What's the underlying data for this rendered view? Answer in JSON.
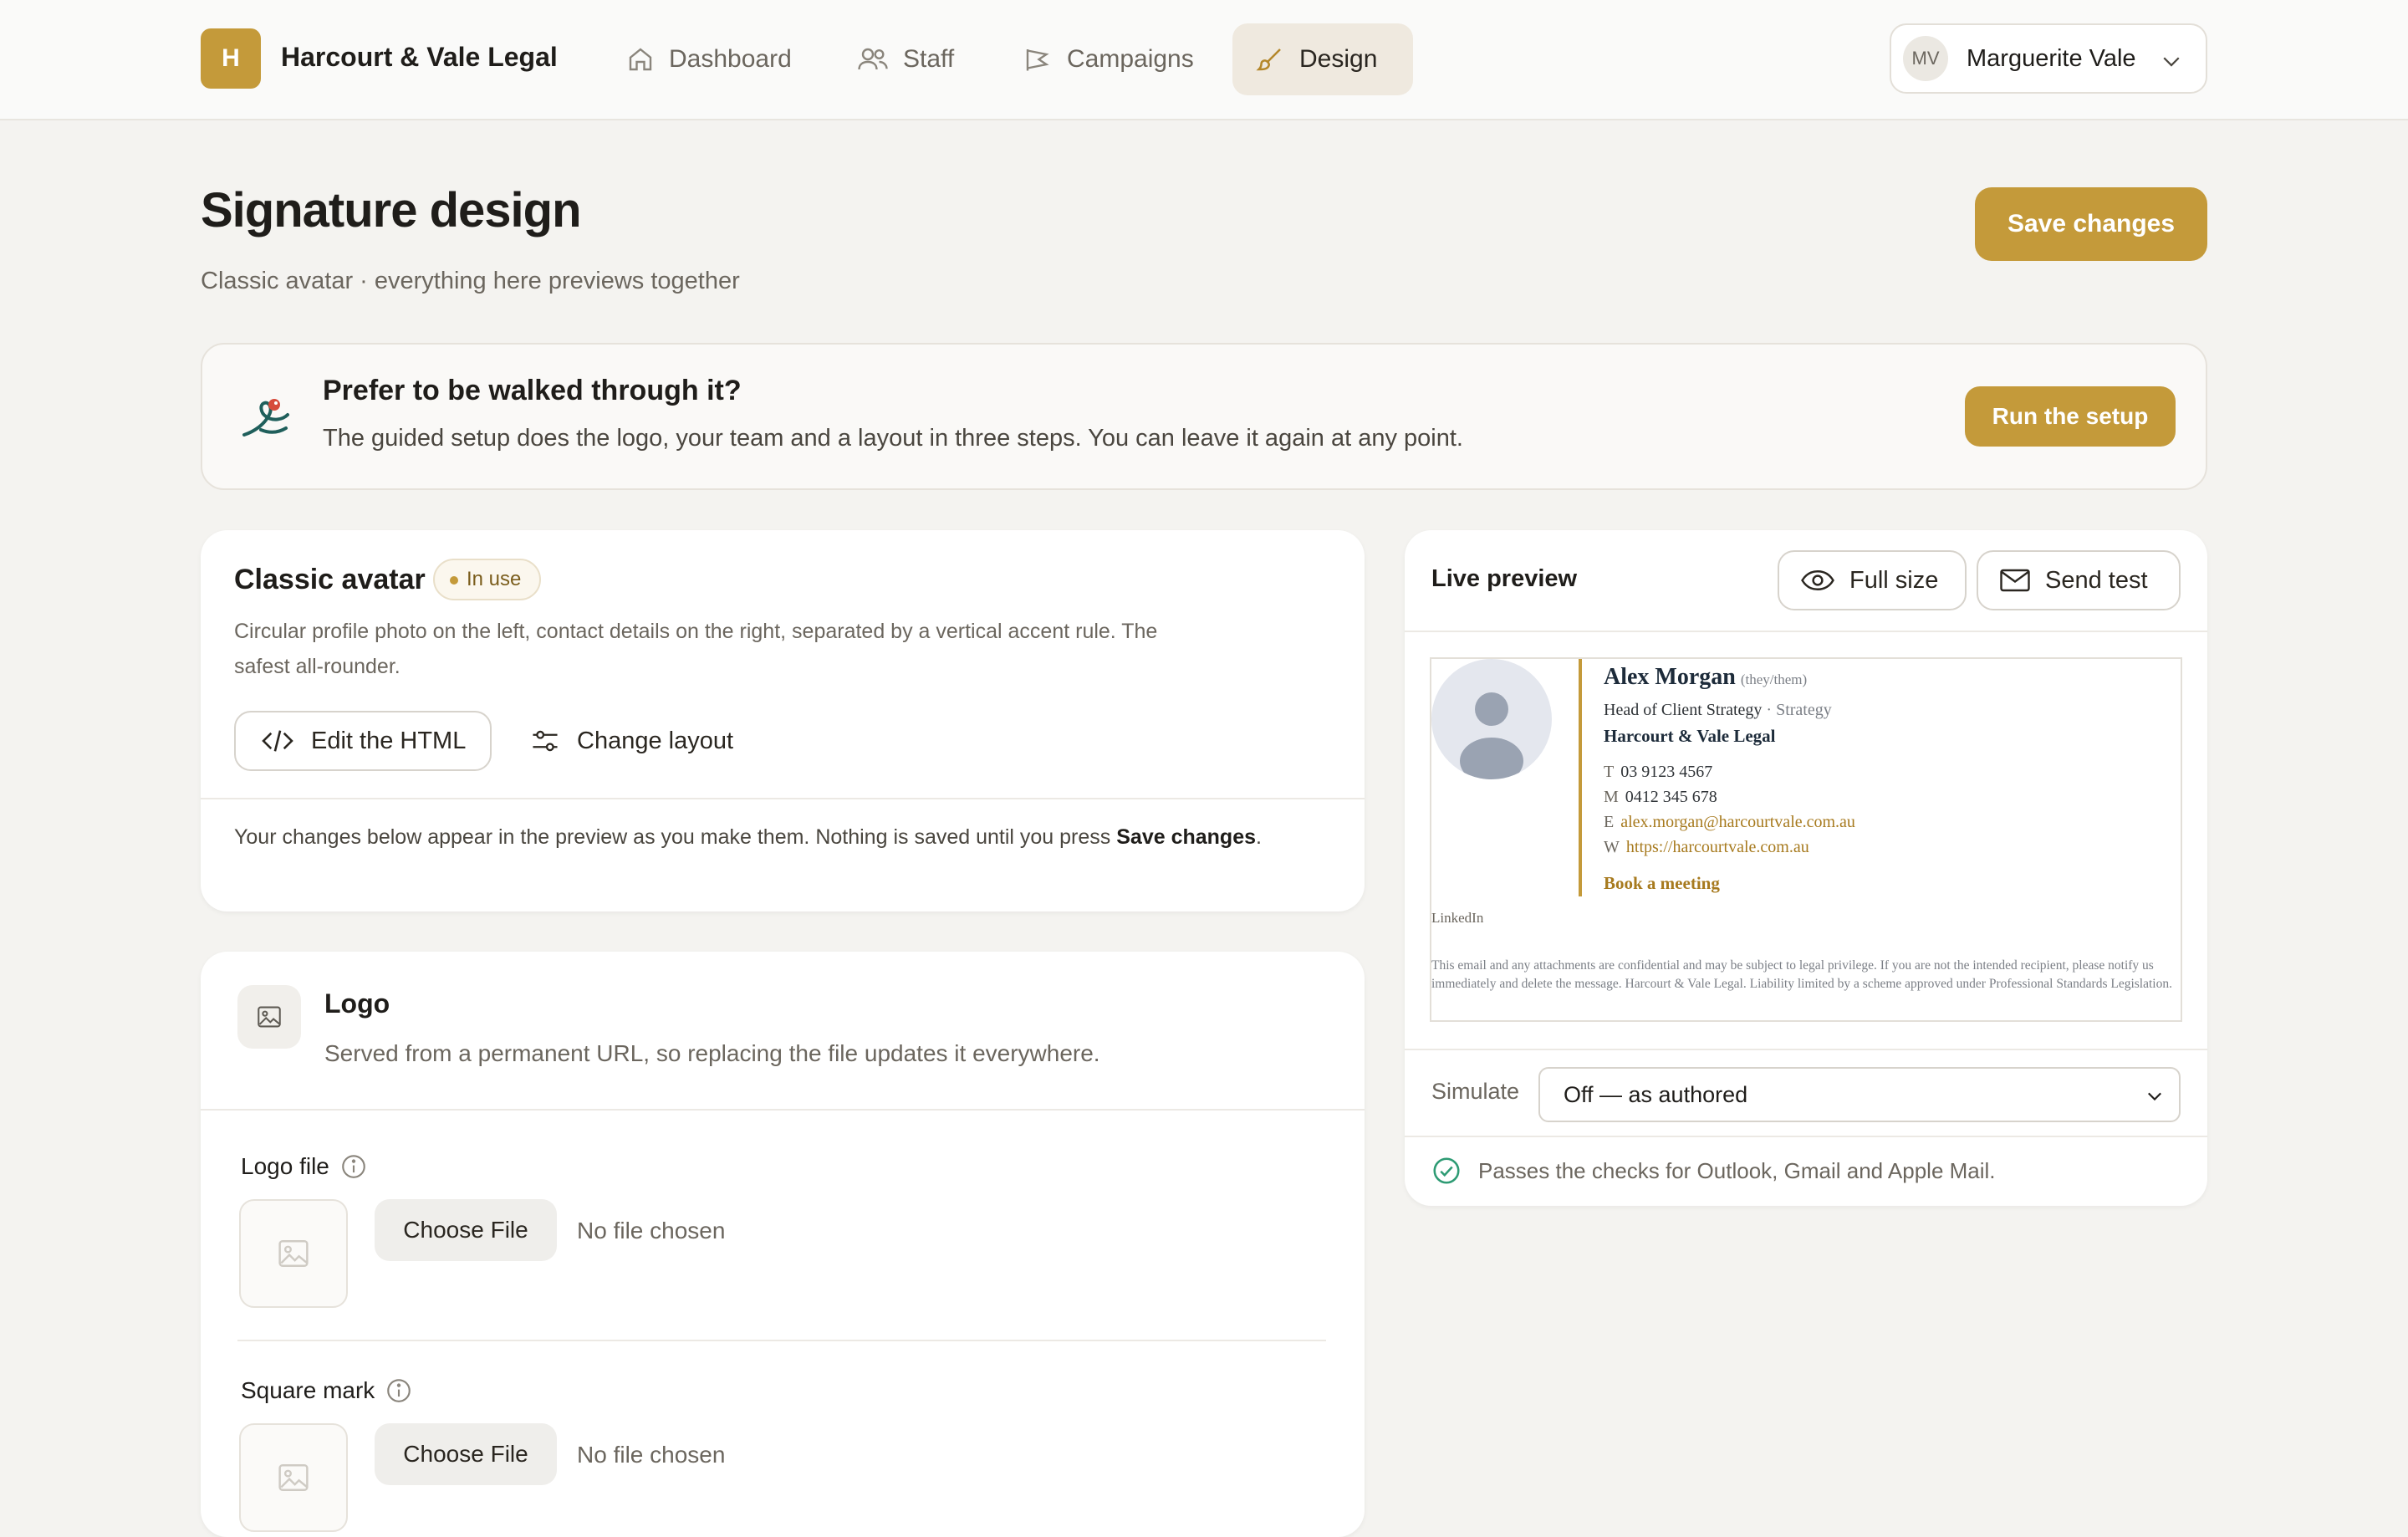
{
  "nav": {
    "brand_initial": "H",
    "brand_name": "Harcourt & Vale Legal",
    "items": [
      {
        "label": "Dashboard",
        "icon": "home-icon"
      },
      {
        "label": "Staff",
        "icon": "users-icon"
      },
      {
        "label": "Campaigns",
        "icon": "megaphone-icon"
      },
      {
        "label": "Design",
        "icon": "brush-icon",
        "active": true
      }
    ],
    "user": {
      "initials": "MV",
      "name": "Marguerite Vale"
    }
  },
  "header": {
    "title": "Signature design",
    "subtitle": "Classic avatar · everything here previews together",
    "save_label": "Save changes"
  },
  "walkthrough": {
    "title": "Prefer to be walked through it?",
    "description": "The guided setup does the logo, your team and a layout in three steps. You can leave it again at any point.",
    "button_label": "Run the setup"
  },
  "layout_card": {
    "title": "Classic avatar",
    "badge": "In use",
    "description": "Circular profile photo on the left, contact details on the right, separated by a vertical accent rule. The safest all-rounder.",
    "edit_html_label": "Edit the HTML",
    "change_layout_label": "Change layout",
    "note_prefix": "Your changes below appear in the preview as you make them. Nothing is saved until you press ",
    "note_bold": "Save changes",
    "note_suffix": "."
  },
  "logo_card": {
    "title": "Logo",
    "description": "Served from a permanent URL, so replacing the file updates it everywhere.",
    "fields": [
      {
        "label": "Logo file",
        "button": "Choose File",
        "status": "No file chosen"
      },
      {
        "label": "Square mark",
        "button": "Choose File",
        "status": "No file chosen"
      }
    ]
  },
  "preview": {
    "title": "Live preview",
    "full_size_label": "Full size",
    "send_test_label": "Send test",
    "signature": {
      "name": "Alex Morgan",
      "pronouns": "(they/them)",
      "role": "Head of Client Strategy",
      "department": "· Strategy",
      "company": "Harcourt & Vale Legal",
      "phone_prefix": "T",
      "phone": "03 9123 4567",
      "mobile_prefix": "M",
      "mobile": "0412 345 678",
      "email_prefix": "E",
      "email": "alex.morgan@harcourtvale.com.au",
      "web_prefix": "W",
      "web": "https://harcourtvale.com.au",
      "cta": "Book a meeting",
      "linkedin": "LinkedIn",
      "disclaimer": "This email and any attachments are confidential and may be subject to legal privilege. If you are not the intended recipient, please notify us immediately and delete the message. Harcourt & Vale Legal. Liability limited by a scheme approved under Professional Standards Legislation."
    },
    "simulate_label": "Simulate",
    "simulate_value": "Off — as authored",
    "check_message": "Passes the checks for Outlook, Gmail and Apple Mail."
  },
  "colors": {
    "accent": "#c49a3a",
    "background": "#f4f3f0",
    "success": "#2e9b74"
  }
}
